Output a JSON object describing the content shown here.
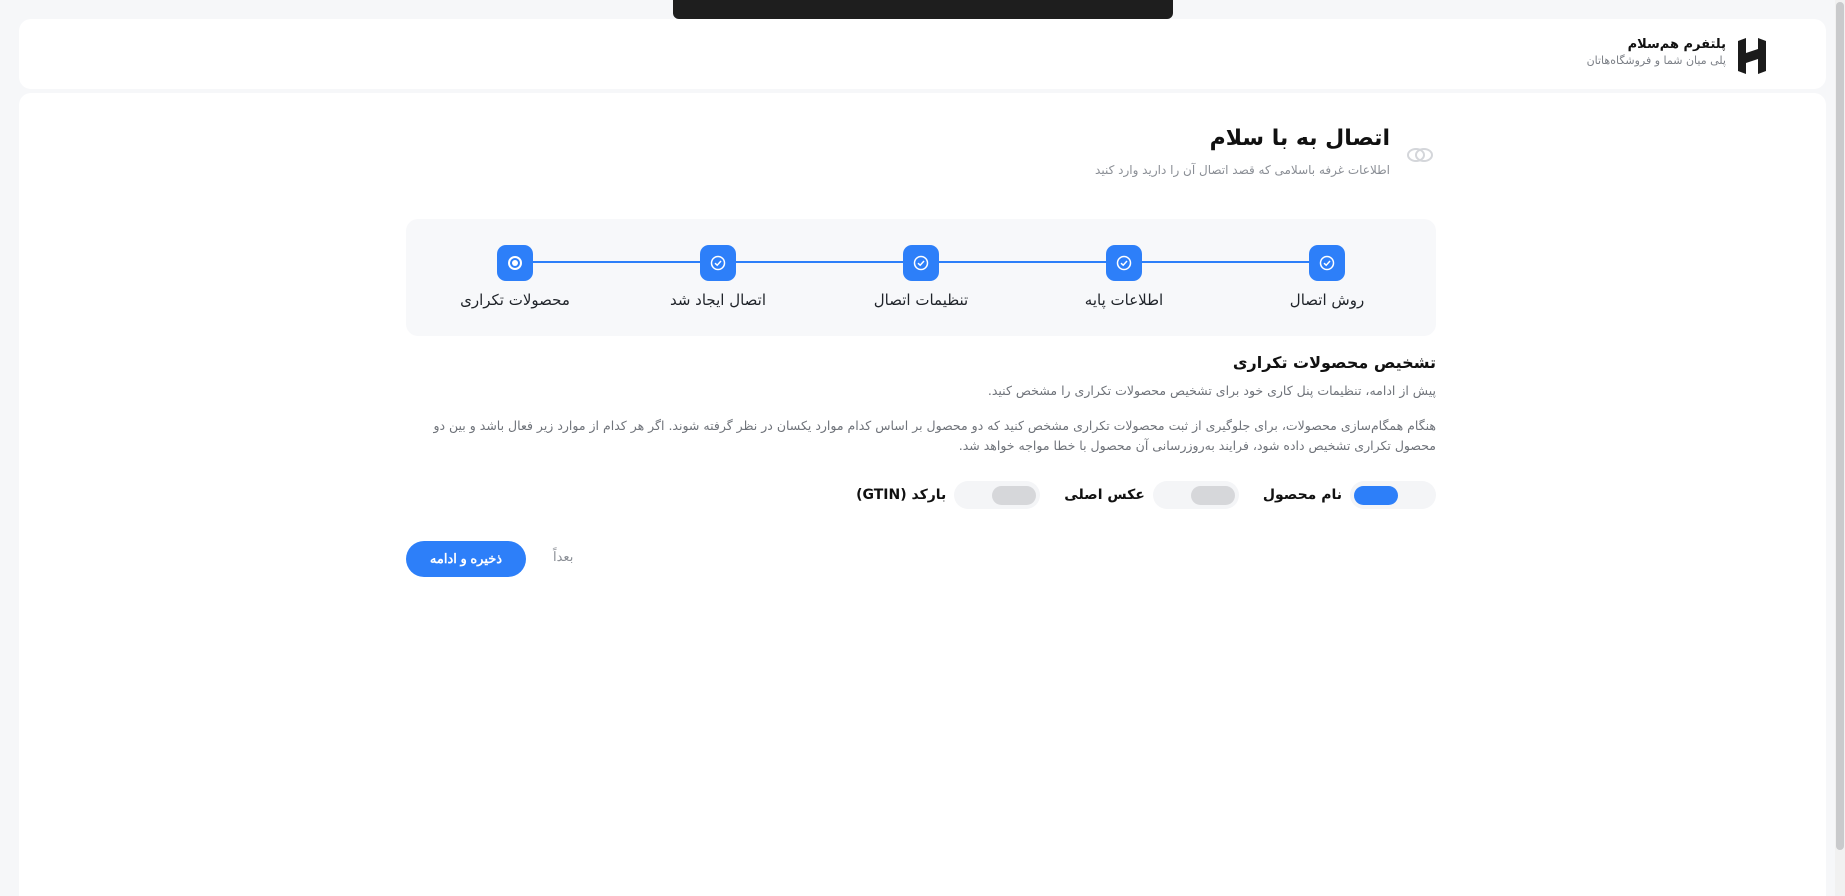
{
  "brand": {
    "name": "پلتفرم هم‌سلام",
    "tagline": "پلی میان شما و فروشگاه‌هاتان"
  },
  "header": {
    "title": "اتصال به با سلام",
    "subtitle": "اطلاعات غرفه باسلامی که قصد اتصال آن را دارید وارد کنید"
  },
  "stepper": {
    "steps": [
      {
        "label": "روش اتصال",
        "state": "done"
      },
      {
        "label": "اطلاعات پایه",
        "state": "done"
      },
      {
        "label": "تنظیمات اتصال",
        "state": "done"
      },
      {
        "label": "اتصال ایجاد شد",
        "state": "done"
      },
      {
        "label": "محصولات تکراری",
        "state": "current"
      }
    ]
  },
  "section": {
    "title": "تشخیص محصولات تکراری",
    "description": "پیش از ادامه، تنظیمات پنل کاری خود برای تشخیص محصولات تکراری را مشخص کنید.",
    "note": "هنگام همگام‌سازی محصولات، برای جلوگیری از ثبت محصولات تکراری مشخص کنید که دو محصول بر اساس کدام موارد یکسان در نظر گرفته شوند. اگر هر کدام از موارد زیر فعال باشد و بین دو محصول تکراری تشخیص داده شود، فرایند به‌روزرسانی آن محصول با خطا مواجه خواهد شد."
  },
  "toggles": [
    {
      "label": "نام محصول",
      "on": true
    },
    {
      "label": "عکس اصلی",
      "on": false
    },
    {
      "label": "بارکد (GTIN)",
      "on": false
    }
  ],
  "actions": {
    "save_label": "ذخیره و ادامه",
    "later_label": "بعداً"
  },
  "colors": {
    "accent": "#2d7ff9",
    "toggle_off": "#d6d7da"
  }
}
